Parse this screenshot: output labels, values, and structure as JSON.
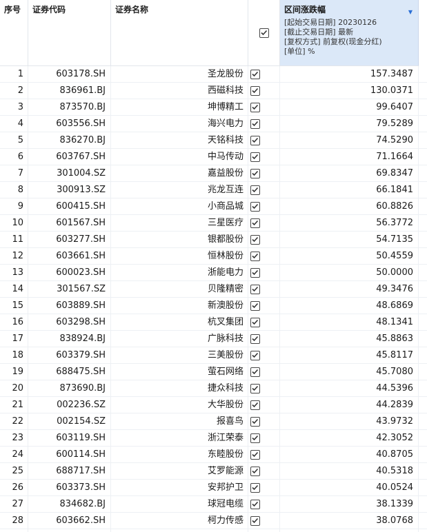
{
  "header": {
    "seq": "序号",
    "code": "证券代码",
    "name": "证券名称",
    "range_title": "区间涨跌幅",
    "param_start": "[起始交易日期]   20230126",
    "param_end": "[截止交易日期]   最新",
    "param_adjust": "[复权方式]   前复权(现金分红)",
    "param_unit": "[单位]   %"
  },
  "colors": {
    "header_highlight": "#dbe8f8",
    "sort_arrow": "#2b6fd6"
  },
  "rows": [
    {
      "seq": "1",
      "code": "603178.SH",
      "name": "圣龙股份",
      "value": "157.3487"
    },
    {
      "seq": "2",
      "code": "836961.BJ",
      "name": "西磁科技",
      "value": "130.0371"
    },
    {
      "seq": "3",
      "code": "873570.BJ",
      "name": "坤博精工",
      "value": "99.6407"
    },
    {
      "seq": "4",
      "code": "603556.SH",
      "name": "海兴电力",
      "value": "79.5289"
    },
    {
      "seq": "5",
      "code": "836270.BJ",
      "name": "天铭科技",
      "value": "74.5290"
    },
    {
      "seq": "6",
      "code": "603767.SH",
      "name": "中马传动",
      "value": "71.1664"
    },
    {
      "seq": "7",
      "code": "301004.SZ",
      "name": "嘉益股份",
      "value": "69.8347"
    },
    {
      "seq": "8",
      "code": "300913.SZ",
      "name": "兆龙互连",
      "value": "66.1841"
    },
    {
      "seq": "9",
      "code": "600415.SH",
      "name": "小商品城",
      "value": "60.8826"
    },
    {
      "seq": "10",
      "code": "601567.SH",
      "name": "三星医疗",
      "value": "56.3772"
    },
    {
      "seq": "11",
      "code": "603277.SH",
      "name": "银都股份",
      "value": "54.7135"
    },
    {
      "seq": "12",
      "code": "603661.SH",
      "name": "恒林股份",
      "value": "50.4559"
    },
    {
      "seq": "13",
      "code": "600023.SH",
      "name": "浙能电力",
      "value": "50.0000"
    },
    {
      "seq": "14",
      "code": "301567.SZ",
      "name": "贝隆精密",
      "value": "49.3476"
    },
    {
      "seq": "15",
      "code": "603889.SH",
      "name": "新澳股份",
      "value": "48.6869"
    },
    {
      "seq": "16",
      "code": "603298.SH",
      "name": "杭叉集团",
      "value": "48.1341"
    },
    {
      "seq": "17",
      "code": "838924.BJ",
      "name": "广脉科技",
      "value": "45.8863"
    },
    {
      "seq": "18",
      "code": "603379.SH",
      "name": "三美股份",
      "value": "45.8117"
    },
    {
      "seq": "19",
      "code": "688475.SH",
      "name": "萤石网络",
      "value": "45.7080"
    },
    {
      "seq": "20",
      "code": "873690.BJ",
      "name": "捷众科技",
      "value": "44.5396"
    },
    {
      "seq": "21",
      "code": "002236.SZ",
      "name": "大华股份",
      "value": "44.2839"
    },
    {
      "seq": "22",
      "code": "002154.SZ",
      "name": "报喜鸟",
      "value": "43.9732"
    },
    {
      "seq": "23",
      "code": "603119.SH",
      "name": "浙江荣泰",
      "value": "42.3052"
    },
    {
      "seq": "24",
      "code": "600114.SH",
      "name": "东睦股份",
      "value": "40.8705"
    },
    {
      "seq": "25",
      "code": "688717.SH",
      "name": "艾罗能源",
      "value": "40.5318"
    },
    {
      "seq": "26",
      "code": "603373.SH",
      "name": "安邦护卫",
      "value": "40.0524"
    },
    {
      "seq": "27",
      "code": "834682.BJ",
      "name": "球冠电缆",
      "value": "38.1339"
    },
    {
      "seq": "28",
      "code": "603662.SH",
      "name": "柯力传感",
      "value": "38.0768"
    }
  ]
}
